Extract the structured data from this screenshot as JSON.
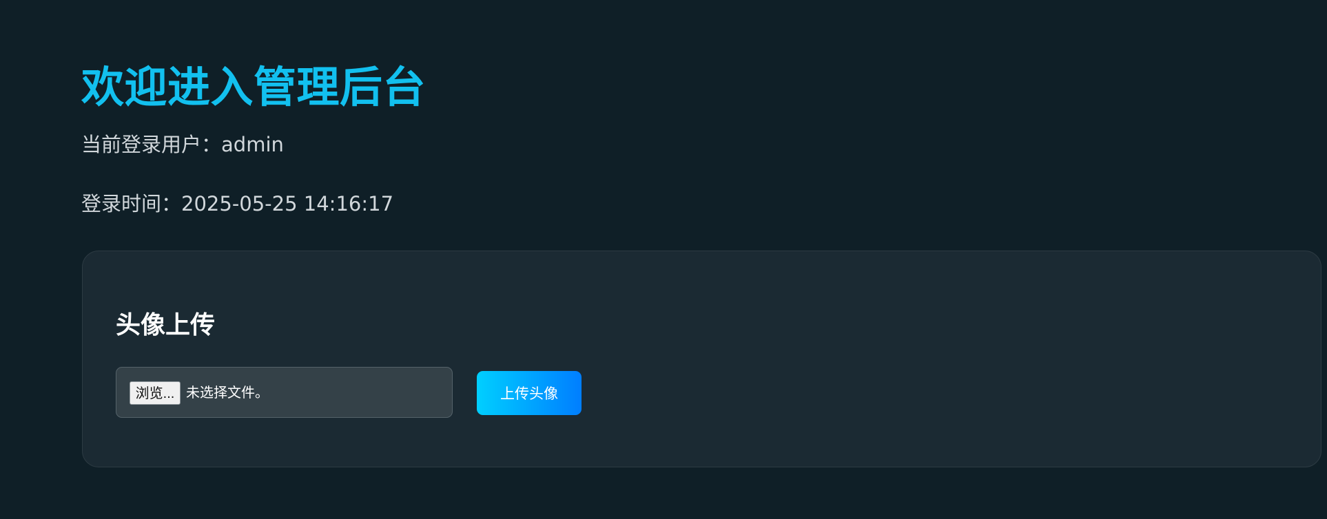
{
  "header": {
    "title": "欢迎进入管理后台"
  },
  "user_info": {
    "current_user_label": "当前登录用户：",
    "current_user_value": "admin",
    "login_time_label": "登录时间：",
    "login_time_value": "2025-05-25 14:16:17"
  },
  "avatar_upload": {
    "title": "头像上传",
    "file_input": {
      "browse_label": "浏览...",
      "status_text": "未选择文件。"
    },
    "submit_label": "上传头像"
  }
}
